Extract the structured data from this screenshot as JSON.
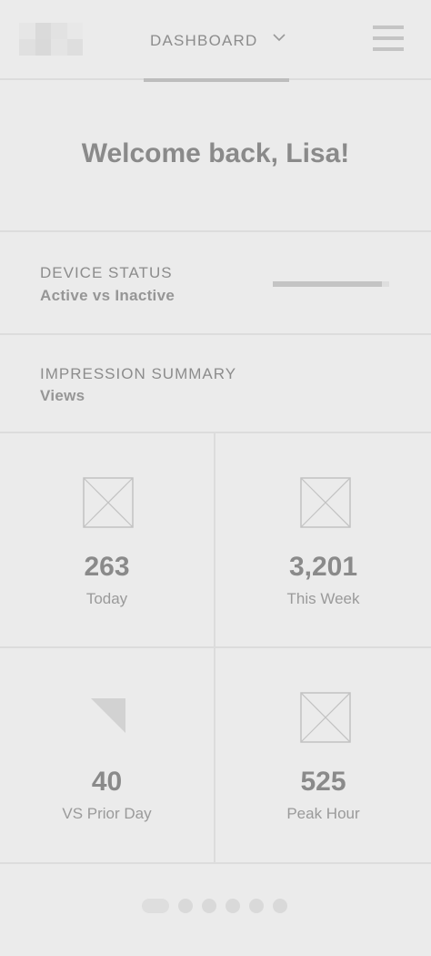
{
  "header": {
    "nav_label": "DASHBOARD",
    "logo_icon": "logo-placeholder-icon",
    "dropdown_icon": "chevron-down-icon",
    "menu_icon": "hamburger-menu-icon"
  },
  "welcome": {
    "title": "Welcome back, Lisa!"
  },
  "device_status": {
    "title": "DEVICE STATUS",
    "subtitle": "Active vs Inactive",
    "active_fraction": 0.94
  },
  "impression_summary": {
    "title": "IMPRESSION SUMMARY",
    "subtitle": "Views"
  },
  "stats": [
    {
      "value": "263",
      "label": "Today",
      "icon": "image-placeholder-icon"
    },
    {
      "value": "3,201",
      "label": "This Week",
      "icon": "image-placeholder-icon"
    },
    {
      "value": "40",
      "label": "VS Prior Day",
      "icon": "triangle-icon"
    },
    {
      "value": "525",
      "label": "Peak Hour",
      "icon": "image-placeholder-icon"
    }
  ],
  "pager": {
    "total": 6,
    "current": 1
  },
  "colors": {
    "background": "#ebebeb",
    "divider": "#dcdcdc",
    "text": "#8a8a8a",
    "muted": "#c4c4c4"
  }
}
